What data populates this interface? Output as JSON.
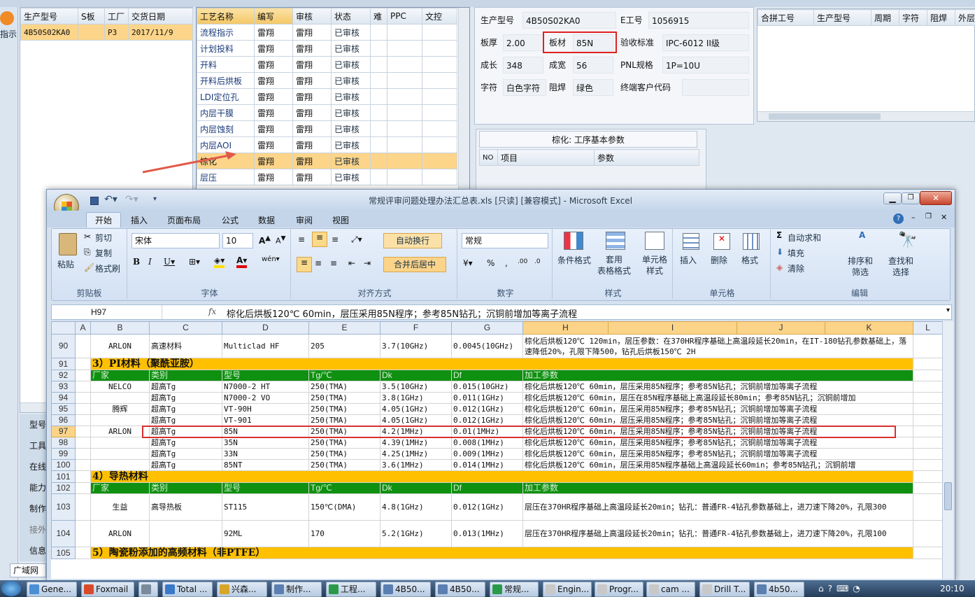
{
  "left_panel": {
    "headers": [
      "生产型号",
      "S板",
      "工厂",
      "交货日期"
    ],
    "row": [
      "4B50S02KA0",
      "",
      "P3",
      "2017/11/9"
    ],
    "side_top_label": "指示",
    "side_buttons": [
      "型号",
      "工具",
      "在线",
      "能力",
      "制作",
      "接外",
      "信息"
    ],
    "bottom_tab": "广域网"
  },
  "process_table": {
    "headers": [
      "工艺名称",
      "编写",
      "审核",
      "状态",
      "难",
      "PPC",
      "文控"
    ],
    "rows": [
      [
        "流程指示",
        "雷翔",
        "雷翔",
        "已审核"
      ],
      [
        "计划投料",
        "雷翔",
        "雷翔",
        "已审核"
      ],
      [
        "开料",
        "雷翔",
        "雷翔",
        "已审核"
      ],
      [
        "开料后烘板",
        "雷翔",
        "雷翔",
        "已审核"
      ],
      [
        "LDI定位孔",
        "雷翔",
        "雷翔",
        "已审核"
      ],
      [
        "内层干膜",
        "雷翔",
        "雷翔",
        "已审核"
      ],
      [
        "内层蚀刻",
        "雷翔",
        "雷翔",
        "已审核"
      ],
      [
        "内层AOI",
        "雷翔",
        "雷翔",
        "已审核"
      ],
      [
        "棕化",
        "雷翔",
        "雷翔",
        "已审核"
      ],
      [
        "层压",
        "雷翔",
        "雷翔",
        "已审核"
      ]
    ]
  },
  "info_panel": {
    "l1": "生产型号",
    "v1": "4B50S02KA0",
    "l2": "E工号",
    "v2": "1056915",
    "l3": "板厚",
    "v3": "2.00",
    "l4": "板材",
    "v4": "85N",
    "l5": "验收标准",
    "v5": "IPC-6012 II级",
    "l6": "成长",
    "v6": "348",
    "l7": "成宽",
    "v7": "56",
    "l8": "PNL规格",
    "v8": "1P=10U",
    "l9": "字符",
    "v9": "白色字符",
    "l10": "阻焊",
    "v10": "绿色",
    "l11": "终端客户代码",
    "v11": ""
  },
  "merge_table": {
    "headers": [
      "合拼工号",
      "生产型号",
      "周期",
      "字符",
      "阻焊",
      "外层"
    ]
  },
  "param_panel": {
    "title": "棕化: 工序基本参数",
    "headers": [
      "NO",
      "项目",
      "参数"
    ]
  },
  "excel": {
    "title": "常规评审问题处理办法汇总表.xls [只读] [兼容模式] - Microsoft Excel",
    "tabs": [
      "开始",
      "插入",
      "页面布局",
      "公式",
      "数据",
      "审阅",
      "视图"
    ],
    "groups": {
      "clipboard": {
        "label": "剪贴板",
        "paste": "粘贴",
        "cut": "剪切",
        "copy": "复制",
        "painter": "格式刷"
      },
      "font": {
        "label": "字体",
        "name": "宋体",
        "size": "10"
      },
      "align": {
        "label": "对齐方式",
        "wrap": "自动换行",
        "merge": "合并后居中"
      },
      "number": {
        "label": "数字",
        "format": "常规"
      },
      "styles": {
        "label": "样式",
        "cond": "条件格式",
        "table": "套用\n表格格式",
        "cell": "单元格\n样式"
      },
      "cells": {
        "label": "单元格",
        "insert": "插入",
        "delete": "删除",
        "format": "格式"
      },
      "edit": {
        "label": "编辑",
        "autosum": "自动求和",
        "fill": "填充",
        "clear": "清除",
        "sort": "排序和\n筛选",
        "find": "查找和\n选择"
      }
    },
    "namebox": "H97",
    "formula": "棕化后烘板120℃ 60min，层压采用85N程序；参考85N钻孔；沉铜前增加等离子流程",
    "cols": [
      "A",
      "B",
      "C",
      "D",
      "E",
      "F",
      "G",
      "H",
      "I",
      "J",
      "K",
      "L"
    ],
    "rows": [
      {
        "n": "90",
        "t": "data",
        "b": "ARLON",
        "c": "高速材料",
        "d": "Multiclad HF",
        "e": "205",
        "f": "3.7(10GHz)",
        "g": "0.0045(10GHz)",
        "h": "棕化后烘板120℃ 120min，层压参数：在370HR程序基础上高温段延长20min，在IT-180钻孔参数基础上，落速降低20%，孔限下降500，钻孔后烘板150℃ 2H"
      },
      {
        "n": "91",
        "t": "sec",
        "b": "3）PI材料（聚酰亚胺）"
      },
      {
        "n": "92",
        "t": "hdr",
        "b": "厂家",
        "c": "类别",
        "d": "型号",
        "e": "Tg/℃",
        "f": "Dk",
        "g": "Df",
        "h": "加工参数"
      },
      {
        "n": "93",
        "t": "data",
        "b": "NELCO",
        "c": "超高Tg",
        "d": "N7000-2 HT",
        "e": "250(TMA)",
        "f": "3.5(10GHz)",
        "g": "0.015(10GHz)",
        "h": "棕化后烘板120℃ 60min，层压采用85N程序；参考85N钻孔；沉铜前增加等离子流程"
      },
      {
        "n": "94",
        "t": "data",
        "b": "",
        "c": "超高Tg",
        "d": "N7000-2 VO",
        "e": "250(TMA)",
        "f": "3.8(1GHz)",
        "g": "0.011(1GHz)",
        "h": "棕化后烘板120℃ 60min，层压在85N程序基础上高温段延长80min；参考85N钻孔；沉铜前增加"
      },
      {
        "n": "95",
        "t": "data",
        "b": "腾辉",
        "c": "超高Tg",
        "d": "VT-90H",
        "e": "250(TMA)",
        "f": "4.05(1GHz)",
        "g": "0.012(1GHz)",
        "h": "棕化后烘板120℃ 60min，层压采用85N程序；参考85N钻孔；沉铜前增加等离子流程"
      },
      {
        "n": "96",
        "t": "data",
        "b": "",
        "c": "超高Tg",
        "d": "VT-901",
        "e": "250(TMA)",
        "f": "4.05(1GHz)",
        "g": "0.012(1GHz)",
        "h": "棕化后烘板120℃ 60min，层压采用85N程序；参考85N钻孔；沉铜前增加等离子流程"
      },
      {
        "n": "97",
        "t": "data",
        "b": "ARLON",
        "c": "超高Tg",
        "d": "85N",
        "e": "250(TMA)",
        "f": "4.2(1MHz)",
        "g": "0.01(1MHz)",
        "h": "棕化后烘板120℃ 60min，层压采用85N程序；参考85N钻孔；沉铜前增加等离子流程"
      },
      {
        "n": "98",
        "t": "data",
        "b": "",
        "c": "超高Tg",
        "d": "35N",
        "e": "250(TMA)",
        "f": "4.39(1MHz)",
        "g": "0.008(1MHz)",
        "h": "棕化后烘板120℃ 60min，层压采用85N程序；参考85N钻孔；沉铜前增加等离子流程"
      },
      {
        "n": "99",
        "t": "data",
        "b": "",
        "c": "超高Tg",
        "d": "33N",
        "e": "250(TMA)",
        "f": "4.25(1MHz)",
        "g": "0.009(1MHz)",
        "h": "棕化后烘板120℃ 60min，层压采用85N程序；参考85N钻孔；沉铜前增加等离子流程"
      },
      {
        "n": "100",
        "t": "data",
        "b": "",
        "c": "超高Tg",
        "d": "85NT",
        "e": "250(TMA)",
        "f": "3.6(1MHz)",
        "g": "0.014(1MHz)",
        "h": "棕化后烘板120℃ 60min，层压采用85N程序基础上高温段延长60min；参考85N钻孔；沉铜前增"
      },
      {
        "n": "101",
        "t": "sec",
        "b": "4）导热材料"
      },
      {
        "n": "102",
        "t": "hdr",
        "b": "厂家",
        "c": "类别",
        "d": "型号",
        "e": "Tg/℃",
        "f": "Dk",
        "g": "Df",
        "h": "加工参数"
      },
      {
        "n": "103",
        "t": "data",
        "b": "生益",
        "c": "高导热板",
        "d": "ST115",
        "e": "150℃(DMA)",
        "f": "4.8(1GHz)",
        "g": "0.012(1GHz)",
        "h": "层压在370HR程序基础上高温段延长20min；钻孔：普通FR-4钻孔参数基础上，进刀速下降20%，孔限300"
      },
      {
        "n": "104",
        "t": "data",
        "b": "ARLON",
        "c": "",
        "d": "92ML",
        "e": "170",
        "f": "5.2(1GHz)",
        "g": "0.013(1MHz)",
        "h": "层压在370HR程序基础上高温段延长20min；钻孔：普通FR-4钻孔参数基础上，进刀速下降20%，孔限100"
      },
      {
        "n": "105",
        "t": "sec",
        "b": "5）陶瓷粉添加的高频材料（非PTFE）"
      }
    ]
  },
  "taskbar": {
    "items": [
      "Gene...",
      "Foxmail",
      "",
      "Total ...",
      "兴森...",
      "制作...",
      "工程...",
      "4B50...",
      "4B50...",
      "常规...",
      "Engin...",
      "Progr...",
      "cam ...",
      "Drill T...",
      "4b50..."
    ],
    "clock": "20:10"
  }
}
